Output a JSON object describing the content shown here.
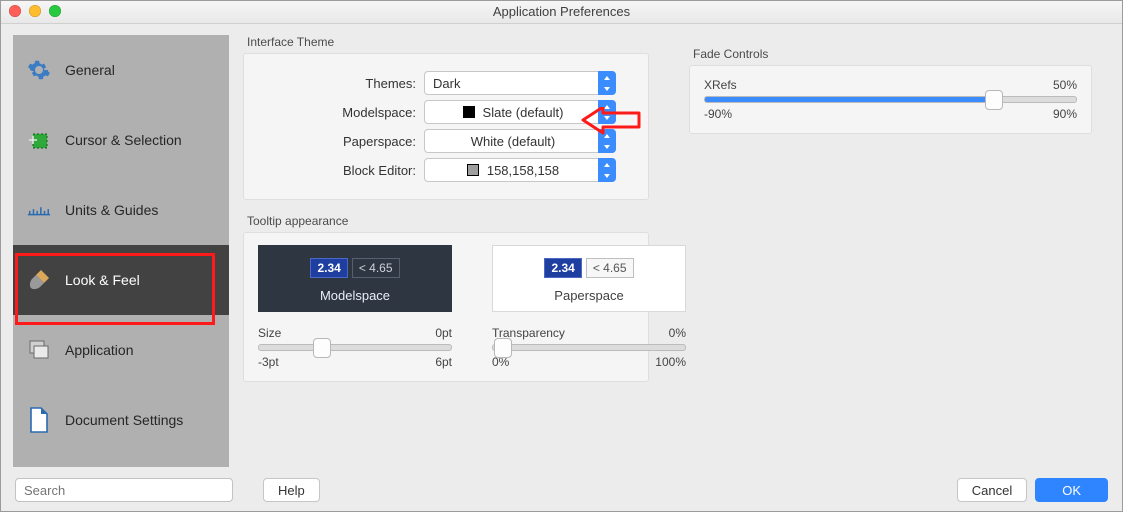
{
  "window_title": "Application Preferences",
  "search_placeholder": "Search",
  "sidebar": {
    "items": [
      {
        "label": "General"
      },
      {
        "label": "Cursor & Selection"
      },
      {
        "label": "Units & Guides"
      },
      {
        "label": "Look & Feel"
      },
      {
        "label": "Application"
      },
      {
        "label": "Document Settings"
      }
    ],
    "active_index": 3
  },
  "interface_theme": {
    "section_label": "Interface Theme",
    "rows": {
      "themes": {
        "label": "Themes:",
        "value": "Dark"
      },
      "modelspace": {
        "label": "Modelspace:",
        "value": "Slate (default)",
        "swatch": "#000000"
      },
      "paperspace": {
        "label": "Paperspace:",
        "value": "White (default)"
      },
      "block_editor": {
        "label": "Block Editor:",
        "value": "158,158,158",
        "swatch": "#9e9e9e"
      }
    }
  },
  "tooltip": {
    "section_label": "Tooltip appearance",
    "previews": {
      "modelspace": {
        "primary": "2.34",
        "secondary": "< 4.65",
        "caption": "Modelspace"
      },
      "paperspace": {
        "primary": "2.34",
        "secondary": "< 4.65",
        "caption": "Paperspace"
      }
    },
    "size": {
      "label": "Size",
      "value_label": "0pt",
      "min_label": "-3pt",
      "max_label": "6pt",
      "percent": 33
    },
    "transparency": {
      "label": "Transparency",
      "value_label": "0%",
      "min_label": "0%",
      "max_label": "100%",
      "percent": 0
    }
  },
  "fade": {
    "section_label": "Fade Controls",
    "xrefs": {
      "label": "XRefs",
      "value_label": "50%",
      "min_label": "-90%",
      "max_label": "90%",
      "percent": 78
    }
  },
  "footer": {
    "help": "Help",
    "cancel": "Cancel",
    "ok": "OK"
  }
}
